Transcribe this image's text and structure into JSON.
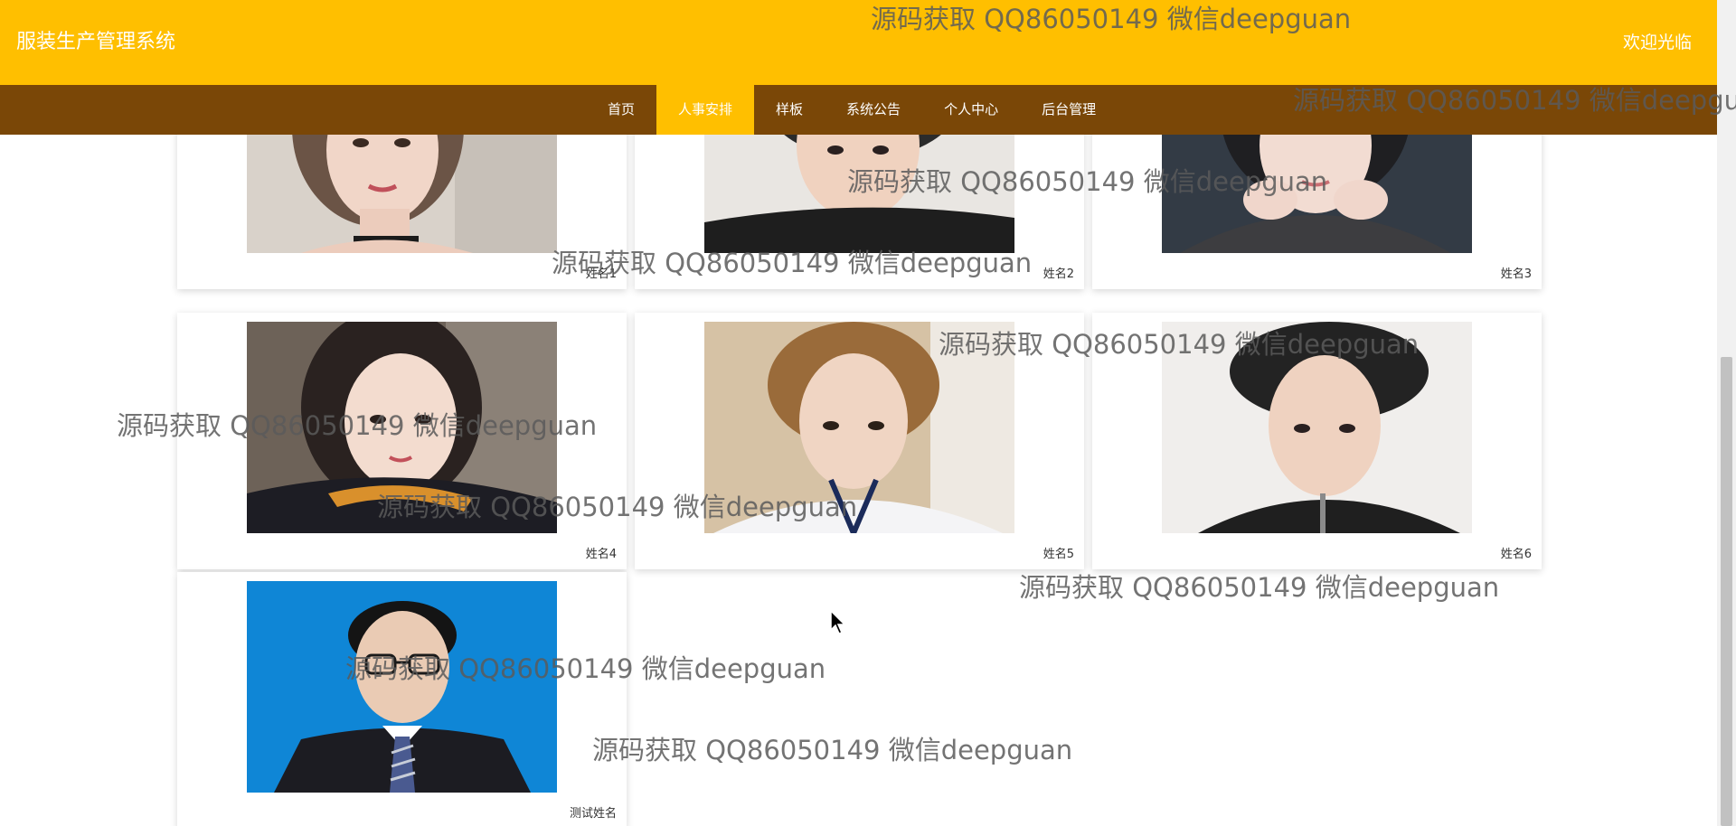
{
  "header": {
    "app_title": "服装生产管理系统",
    "welcome": "欢迎光临",
    "bg_color": "#ffbf00"
  },
  "nav": {
    "bg_color": "#7a4707",
    "items": [
      {
        "label": "首页",
        "active": false
      },
      {
        "label": "人事安排",
        "active": true
      },
      {
        "label": "样板",
        "active": false
      },
      {
        "label": "系统公告",
        "active": false
      },
      {
        "label": "个人中心",
        "active": false
      },
      {
        "label": "后台管理",
        "active": false
      }
    ]
  },
  "cards": [
    {
      "name": "姓名1"
    },
    {
      "name": "姓名2"
    },
    {
      "name": "姓名3"
    },
    {
      "name": "姓名4"
    },
    {
      "name": "姓名5"
    },
    {
      "name": "姓名6"
    },
    {
      "name": "测试姓名"
    }
  ],
  "watermark": {
    "text": "源码获取 QQ86050149 微信deepguan"
  }
}
